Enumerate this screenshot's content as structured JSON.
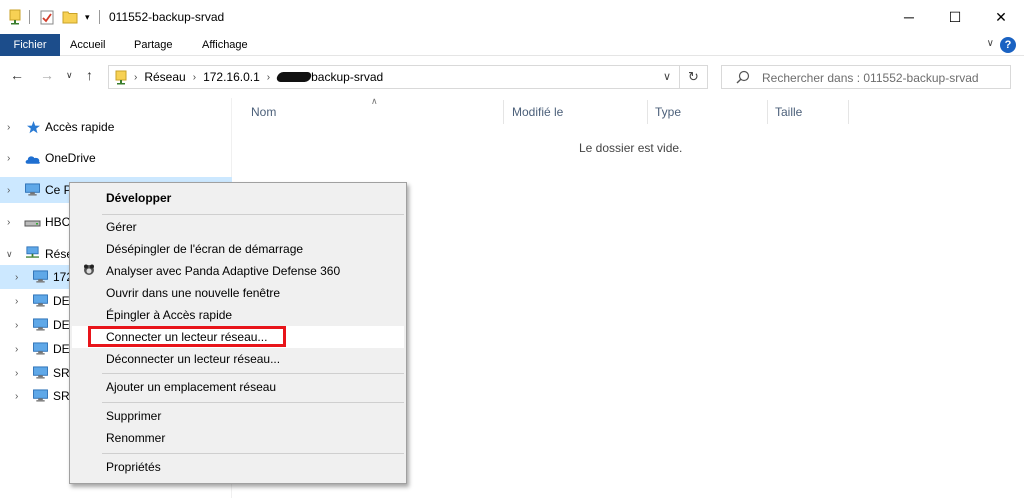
{
  "window": {
    "title": "011552-backup-srvad",
    "controls": {
      "minimize": "─",
      "maximize": "☐",
      "close": "✕"
    }
  },
  "ribbon": {
    "tabs": [
      "Fichier",
      "Accueil",
      "Partage",
      "Affichage"
    ],
    "help": "?"
  },
  "address": {
    "crumbs": [
      "Réseau",
      "172.16.0.1"
    ],
    "last_crumb_suffix": "backup-srvad"
  },
  "search": {
    "placeholder": "Rechercher dans : 011552-backup-srvad"
  },
  "navpane": {
    "items": [
      {
        "label": "Accès rapide",
        "icon": "star-icon"
      },
      {
        "label": "OneDrive",
        "icon": "cloud-icon"
      },
      {
        "label": "Ce P",
        "icon": "computer-icon"
      },
      {
        "label": "HBC",
        "icon": "drive-icon"
      },
      {
        "label": "Rése",
        "icon": "network-icon"
      },
      {
        "label": "172",
        "icon": "computer-icon"
      },
      {
        "label": "DES",
        "icon": "computer-icon"
      },
      {
        "label": "DES",
        "icon": "computer-icon"
      },
      {
        "label": "DES",
        "icon": "computer-icon"
      },
      {
        "label": "SRV",
        "icon": "computer-icon"
      },
      {
        "label": "SRV",
        "icon": "computer-icon"
      }
    ]
  },
  "columns": [
    "Nom",
    "Modifié le",
    "Type",
    "Taille"
  ],
  "empty_message": "Le dossier est vide.",
  "context_menu": {
    "items": [
      "Développer",
      "Gérer",
      "Désépingler de l'écran de démarrage",
      "Analyser avec Panda Adaptive Defense 360",
      "Ouvrir dans une nouvelle fenêtre",
      "Épingler à Accès rapide",
      "Connecter un lecteur réseau...",
      "Déconnecter un lecteur réseau...",
      "Ajouter un emplacement réseau",
      "Supprimer",
      "Renommer",
      "Propriétés"
    ]
  },
  "colors": {
    "file_tab": "#1c4d8b",
    "selection": "#cce8ff",
    "highlight_box": "#e8141a",
    "folder_yellow": "#f7d154"
  }
}
